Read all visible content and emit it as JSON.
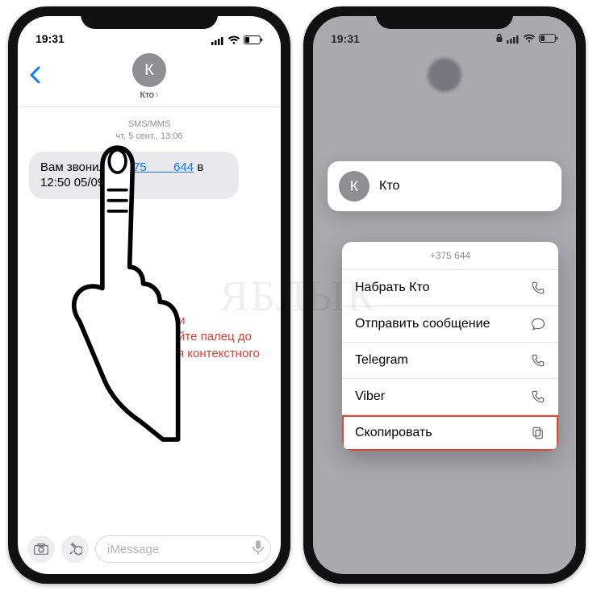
{
  "status": {
    "time": "19:31"
  },
  "phone1": {
    "contact_letter": "К",
    "contact_name": "Кто",
    "sms_label": "SMS/MMS",
    "sms_date": "чт, 5 сент., 13:06",
    "bubble_prefix": "Вам звонили: ",
    "bubble_phone_prefix": "+375",
    "bubble_phone_suffix": "644",
    "bubble_tail": " в 12:50 05/09.",
    "instruction": "Нажмите и удерживайте палец до появления контекстного меню",
    "compose_placeholder": "iMessage"
  },
  "phone2": {
    "contact_letter": "К",
    "contact_name": "Кто",
    "menu_phone": "+375            644",
    "items": [
      {
        "label": "Набрать Кто",
        "icon": "phone",
        "hl": false
      },
      {
        "label": "Отправить сообщение",
        "icon": "message",
        "hl": false
      },
      {
        "label": "Telegram",
        "icon": "phone",
        "hl": false
      },
      {
        "label": "Viber",
        "icon": "phone",
        "hl": false
      },
      {
        "label": "Скопировать",
        "icon": "copy",
        "hl": true
      }
    ]
  },
  "watermark": "ЯБЛЫК"
}
